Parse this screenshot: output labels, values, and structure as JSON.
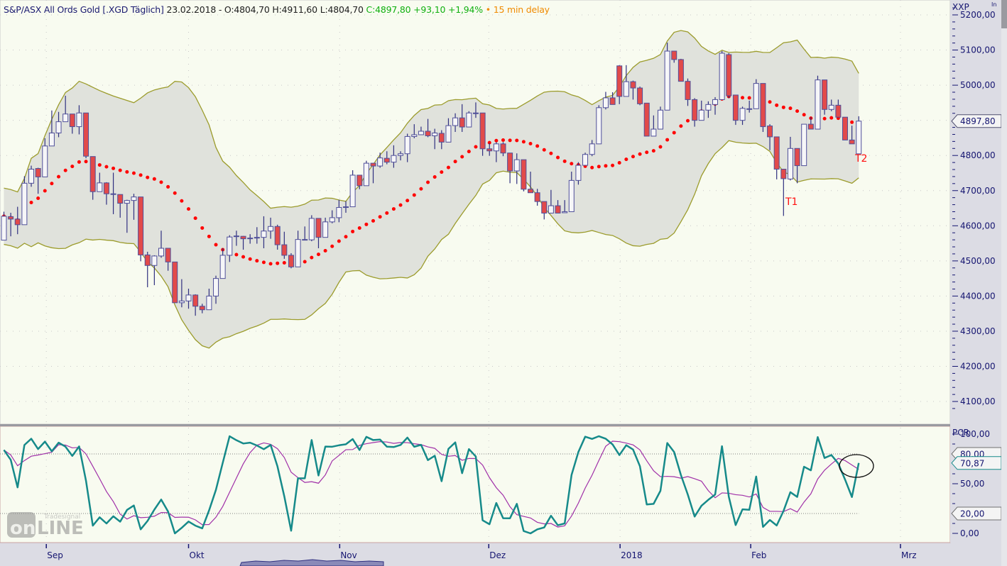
{
  "header": {
    "symbol": "S&P/ASX All Ords Gold [.XGD Täglich]",
    "ohl": "23.02.2018 - O:4804,70 H:4911,60 L:4804,70",
    "change": "C:4897,80 +93,10 +1,94%",
    "delay": "• 15 min delay"
  },
  "price_axis": {
    "title": "XXP",
    "corner_label": "In",
    "last_price_label": "4897,80"
  },
  "indicator_axis": {
    "title": "PCR",
    "last_value_label": "70,87",
    "upper_label": "80,00",
    "lower_label": "20,00"
  },
  "annotations": {
    "t1": "T1",
    "t2": "T2"
  },
  "watermark": {
    "small": "Tradesignal",
    "big": "online"
  },
  "colors": {
    "bg": "#f8fbf0",
    "band_fill": "#e0e2dc",
    "band_line": "#9c9c2c",
    "ma_dots": "#ff0000",
    "up_fill": "#f6f6f8",
    "down_fill": "#e24a4a",
    "candle_line": "#50509a",
    "pcr_line": "#168a8a",
    "pcr_signal": "#a030a8"
  },
  "chart_data": [
    {
      "type": "candlestick",
      "title": "S&P/ASX All Ords Gold [.XGD Täglich]",
      "ylim": [
        4060,
        5240
      ],
      "yticks": [
        4100,
        4200,
        4300,
        4400,
        4500,
        4600,
        4700,
        4800,
        4900,
        5000,
        5100,
        5200
      ],
      "ytick_labels": [
        "4100,00",
        "4200,00",
        "4300,00",
        "4400,00",
        "4500,00",
        "4600,00",
        "4700,00",
        "4800,00",
        "4900,00",
        "5000,00",
        "5100,00",
        "5200,00"
      ],
      "x_months": [
        {
          "label": "Sep",
          "index": 6.2
        },
        {
          "label": "Okt",
          "index": 27.0
        },
        {
          "label": "Nov",
          "index": 49.1
        },
        {
          "label": "Dez",
          "index": 70.9
        },
        {
          "label": "2018",
          "index": 90.1
        },
        {
          "label": "Feb",
          "index": 109.2
        },
        {
          "label": "Mrz",
          "index": 131.1
        }
      ],
      "x_total_slots": 138,
      "overlays": {
        "bollinger_period": 20,
        "bollinger_std": 2,
        "ma_dots": "SMA 20"
      },
      "annotations": [
        {
          "text": "T1",
          "index": 115
        },
        {
          "text": "T2",
          "index": 125
        }
      ],
      "ohlc": [
        [
          4559,
          4640,
          4559,
          4627
        ],
        [
          4626,
          4637,
          4570,
          4619
        ],
        [
          4619,
          4654,
          4576,
          4603
        ],
        [
          4603,
          4741,
          4603,
          4721
        ],
        [
          4721,
          4771,
          4711,
          4761
        ],
        [
          4763,
          4765,
          4691,
          4739
        ],
        [
          4739,
          4849,
          4739,
          4827
        ],
        [
          4827,
          4928,
          4827,
          4864
        ],
        [
          4864,
          4924,
          4852,
          4896
        ],
        [
          4896,
          4970,
          4896,
          4918
        ],
        [
          4918,
          4918,
          4862,
          4882
        ],
        [
          4882,
          4943,
          4860,
          4921
        ],
        [
          4921,
          4921,
          4792,
          4798
        ],
        [
          4797,
          4797,
          4674,
          4697
        ],
        [
          4697,
          4751,
          4697,
          4722
        ],
        [
          4722,
          4724,
          4660,
          4691
        ],
        [
          4690,
          4751,
          4633,
          4691
        ],
        [
          4689,
          4689,
          4623,
          4664
        ],
        [
          4664,
          4674,
          4580,
          4672
        ],
        [
          4672,
          4691,
          4617,
          4682
        ],
        [
          4682,
          4682,
          4499,
          4517
        ],
        [
          4517,
          4526,
          4425,
          4487
        ],
        [
          4487,
          4516,
          4431,
          4514
        ],
        [
          4514,
          4586,
          4509,
          4536
        ],
        [
          4536,
          4536,
          4472,
          4497
        ],
        [
          4497,
          4497,
          4381,
          4381
        ],
        [
          4381,
          4448,
          4368,
          4386
        ],
        [
          4386,
          4421,
          4364,
          4403
        ],
        [
          4403,
          4405,
          4344,
          4371
        ],
        [
          4371,
          4378,
          4351,
          4361
        ],
        [
          4361,
          4421,
          4361,
          4400
        ],
        [
          4400,
          4458,
          4378,
          4450
        ],
        [
          4450,
          4536,
          4450,
          4516
        ],
        [
          4516,
          4573,
          4497,
          4568
        ],
        [
          4569,
          4586,
          4543,
          4571
        ],
        [
          4570,
          4571,
          4532,
          4563
        ],
        [
          4565,
          4576,
          4549,
          4565
        ],
        [
          4566,
          4596,
          4549,
          4567
        ],
        [
          4567,
          4627,
          4536,
          4585
        ],
        [
          4585,
          4623,
          4563,
          4598
        ],
        [
          4598,
          4603,
          4532,
          4546
        ],
        [
          4546,
          4583,
          4506,
          4516
        ],
        [
          4516,
          4522,
          4479,
          4483
        ],
        [
          4483,
          4586,
          4483,
          4561
        ],
        [
          4560,
          4598,
          4560,
          4561
        ],
        [
          4560,
          4630,
          4556,
          4621
        ],
        [
          4621,
          4621,
          4536,
          4567
        ],
        [
          4567,
          4623,
          4567,
          4611
        ],
        [
          4611,
          4644,
          4607,
          4623
        ],
        [
          4623,
          4674,
          4610,
          4652
        ],
        [
          4652,
          4670,
          4637,
          4654
        ],
        [
          4654,
          4758,
          4654,
          4744
        ],
        [
          4744,
          4744,
          4704,
          4714
        ],
        [
          4714,
          4785,
          4721,
          4778
        ],
        [
          4778,
          4778,
          4721,
          4770
        ],
        [
          4770,
          4808,
          4765,
          4793
        ],
        [
          4792,
          4812,
          4775,
          4781
        ],
        [
          4781,
          4829,
          4765,
          4800
        ],
        [
          4800,
          4812,
          4786,
          4805
        ],
        [
          4805,
          4862,
          4781,
          4854
        ],
        [
          4854,
          4889,
          4849,
          4859
        ],
        [
          4859,
          4882,
          4859,
          4869
        ],
        [
          4869,
          4904,
          4852,
          4856
        ],
        [
          4856,
          4876,
          4818,
          4864
        ],
        [
          4863,
          4872,
          4818,
          4838
        ],
        [
          4838,
          4906,
          4838,
          4885
        ],
        [
          4885,
          4920,
          4867,
          4907
        ],
        [
          4907,
          4946,
          4867,
          4881
        ],
        [
          4881,
          4926,
          4881,
          4921
        ],
        [
          4920,
          4951,
          4907,
          4921
        ],
        [
          4921,
          4921,
          4799,
          4819
        ],
        [
          4819,
          4835,
          4799,
          4813
        ],
        [
          4813,
          4838,
          4781,
          4833
        ],
        [
          4833,
          4838,
          4798,
          4807
        ],
        [
          4807,
          4807,
          4721,
          4756
        ],
        [
          4756,
          4806,
          4719,
          4788
        ],
        [
          4788,
          4788,
          4698,
          4704
        ],
        [
          4704,
          4754,
          4694,
          4694
        ],
        [
          4694,
          4705,
          4657,
          4669
        ],
        [
          4669,
          4669,
          4618,
          4636
        ],
        [
          4636,
          4702,
          4636,
          4657
        ],
        [
          4657,
          4673,
          4636,
          4636
        ],
        [
          4637,
          4673,
          4637,
          4640
        ],
        [
          4640,
          4754,
          4640,
          4729
        ],
        [
          4729,
          4781,
          4717,
          4772
        ],
        [
          4772,
          4808,
          4772,
          4803
        ],
        [
          4803,
          4844,
          4798,
          4833
        ],
        [
          4833,
          4943,
          4833,
          4936
        ],
        [
          4936,
          4981,
          4931,
          4964
        ],
        [
          4964,
          4980,
          4945,
          4945
        ],
        [
          5055,
          5057,
          4946,
          4968
        ],
        [
          4968,
          5057,
          4968,
          5010
        ],
        [
          5010,
          5013,
          4959,
          4992
        ],
        [
          4992,
          4996,
          4943,
          4947
        ],
        [
          4949,
          4949,
          4855,
          4855
        ],
        [
          4855,
          4914,
          4855,
          4875
        ],
        [
          4875,
          4939,
          4875,
          4929
        ],
        [
          4929,
          5121,
          4929,
          5097
        ],
        [
          5097,
          5097,
          5064,
          5073
        ],
        [
          5073,
          5075,
          5011,
          5011
        ],
        [
          5011,
          5019,
          4941,
          4959
        ],
        [
          4959,
          4963,
          4882,
          4900
        ],
        [
          4900,
          4956,
          4900,
          4929
        ],
        [
          4929,
          4954,
          4907,
          4945
        ],
        [
          4945,
          4966,
          4916,
          4959
        ],
        [
          4959,
          5097,
          4959,
          5091
        ],
        [
          5087,
          5091,
          4963,
          4970
        ],
        [
          4972,
          4972,
          4887,
          4900
        ],
        [
          4900,
          4939,
          4887,
          4934
        ],
        [
          4932,
          4956,
          4922,
          4933
        ],
        [
          4933,
          5017,
          4933,
          5005
        ],
        [
          5005,
          5005,
          4867,
          4882
        ],
        [
          4884,
          4889,
          4815,
          4853
        ],
        [
          4853,
          4853,
          4732,
          4761
        ],
        [
          4761,
          4761,
          4628,
          4734
        ],
        [
          4733,
          4853,
          4729,
          4820
        ],
        [
          4820,
          4820,
          4721,
          4771
        ],
        [
          4771,
          4889,
          4771,
          4889
        ],
        [
          4889,
          4909,
          4875,
          4875
        ],
        [
          4875,
          5027,
          4875,
          5015
        ],
        [
          5015,
          5015,
          4916,
          4931
        ],
        [
          4931,
          4959,
          4926,
          4943
        ],
        [
          4943,
          4959,
          4909,
          4909
        ],
        [
          4909,
          4909,
          4844,
          4844
        ],
        [
          4844,
          4885,
          4833,
          4833
        ],
        [
          4804.7,
          4911.6,
          4804.7,
          4897.8
        ]
      ]
    },
    {
      "type": "line",
      "title": "PCR",
      "ylim": [
        -5,
        105
      ],
      "yticks": [
        0,
        50,
        100
      ],
      "ytick_labels": [
        "0,00",
        "50,00",
        "100,00"
      ],
      "levels": [
        20,
        80
      ],
      "period": 10,
      "signal_period": 6,
      "last_value": 70.87
    }
  ]
}
